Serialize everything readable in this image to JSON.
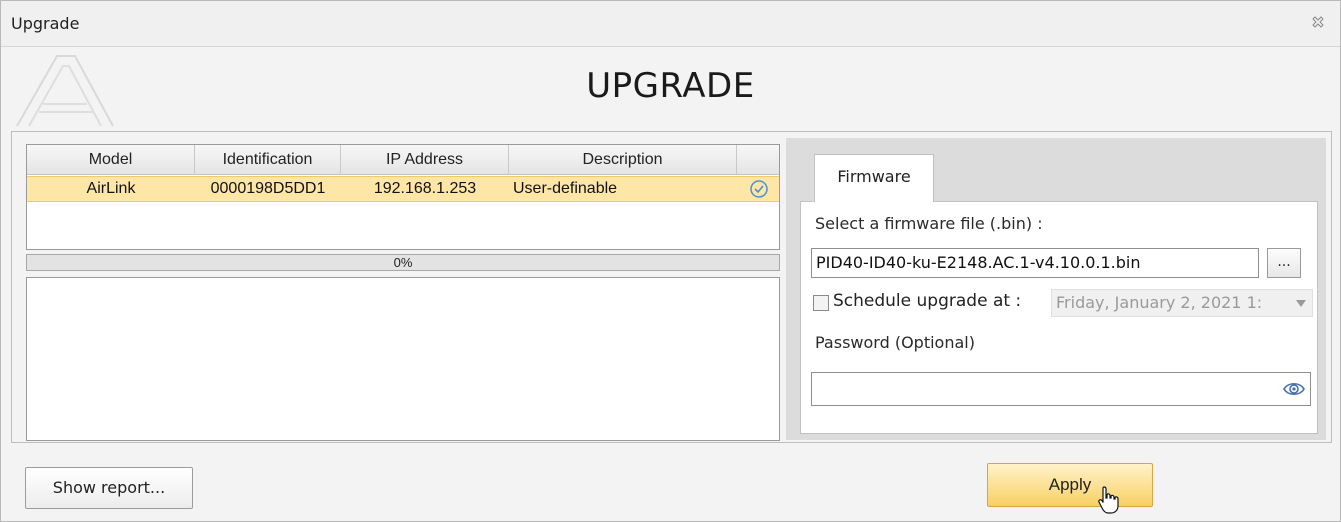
{
  "window": {
    "title": "Upgrade"
  },
  "header": {
    "title": "UPGRADE"
  },
  "table": {
    "columns": [
      "Model",
      "Identification",
      "IP Address",
      "Description"
    ],
    "rows": [
      {
        "model": "AirLink",
        "identification": "0000198D5DD1",
        "ip": "192.168.1.253",
        "description": "User-definable",
        "status_icon": "check-circle-icon"
      }
    ]
  },
  "progress": {
    "label": "0%",
    "value": 0
  },
  "firmware": {
    "tab_label": "Firmware",
    "select_label": "Select a firmware file (.bin) :",
    "file_value": "PID40-ID40-ku-E2148.AC.1-v4.10.0.1.bin",
    "browse_label": "...",
    "schedule_label": "Schedule upgrade at :",
    "schedule_checked": false,
    "schedule_value": "Friday, January 2, 2021 1:",
    "password_label": "Password (Optional)",
    "password_value": ""
  },
  "footer": {
    "report_label": "Show report...",
    "apply_label": "Apply"
  },
  "colors": {
    "selected_row": "#fde6a6",
    "apply_button": "#f8cf64",
    "progress_fill": "#f5c042",
    "check_icon": "#4a8fd6"
  }
}
